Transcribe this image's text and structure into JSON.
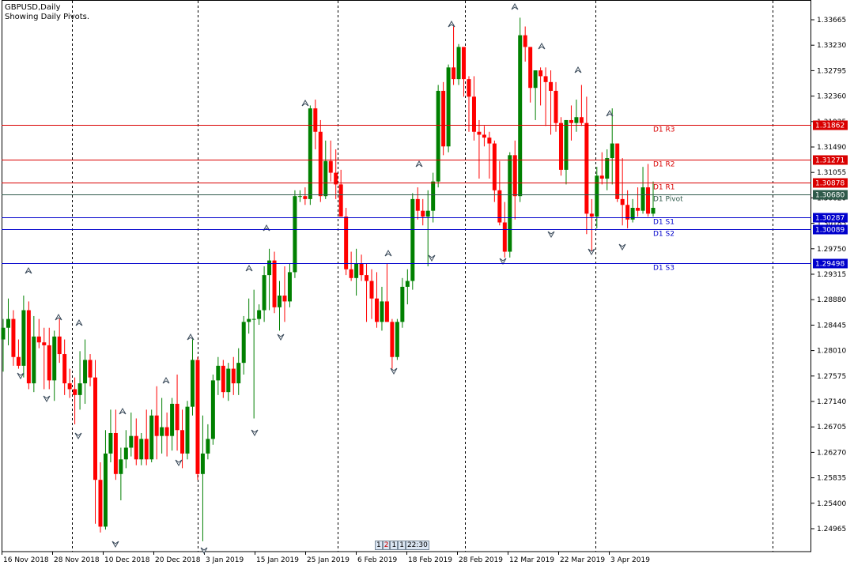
{
  "header": {
    "symbol_label": "GBPUSD,Daily",
    "indicator_label": "Showing Daily Pivots."
  },
  "counter": [
    "1",
    "2",
    "1",
    "1",
    "22:30"
  ],
  "colors": {
    "bull": "#008000",
    "bear": "#ff0000",
    "resistance": "#d90000",
    "support": "#0000cc",
    "pivot": "#2f5a4a",
    "grid": "#000000",
    "fractal": "#3a4a5a"
  },
  "chart_data": {
    "type": "candlestick",
    "symbol": "GBPUSD",
    "timeframe": "Daily",
    "ylim": [
      1.2475,
      1.339
    ],
    "y_ticks": [
      "1.33665",
      "1.33230",
      "1.32795",
      "1.32360",
      "1.31925",
      "1.31490",
      "1.31055",
      "1.30620",
      "1.30185",
      "1.29750",
      "1.29315",
      "1.28880",
      "1.28445",
      "1.28010",
      "1.27575",
      "1.27140",
      "1.26705",
      "1.26270",
      "1.25835",
      "1.25400",
      "1.24965"
    ],
    "x_labels": [
      "16 Nov 2018",
      "28 Nov 2018",
      "10 Dec 2018",
      "20 Dec 2018",
      "3 Jan 2019",
      "15 Jan 2019",
      "25 Jan 2019",
      "6 Feb 2019",
      "18 Feb 2019",
      "28 Feb 2019",
      "12 Mar 2019",
      "22 Mar 2019",
      "3 Apr 2019"
    ],
    "pivot_levels": [
      {
        "name": "D1 R3",
        "value": 1.31862,
        "label": "1.31862",
        "kind": "resistance"
      },
      {
        "name": "D1 R2",
        "value": 1.31271,
        "label": "1.31271",
        "kind": "resistance"
      },
      {
        "name": "D1 R1",
        "value": 1.30878,
        "label": "1.30878",
        "kind": "resistance"
      },
      {
        "name": "D1 Pivot",
        "value": 1.3068,
        "label": "1.30680",
        "kind": "pivot"
      },
      {
        "name": "D1 S1",
        "value": 1.30287,
        "label": "1.30287",
        "kind": "support"
      },
      {
        "name": "D1 S2",
        "value": 1.30089,
        "label": "1.30089",
        "kind": "support"
      },
      {
        "name": "D1 S3",
        "value": 1.29498,
        "label": "1.29498",
        "kind": "support"
      }
    ],
    "candles": [
      {
        "o": 1.282,
        "h": 1.2855,
        "l": 1.2765,
        "c": 1.284
      },
      {
        "o": 1.284,
        "h": 1.289,
        "l": 1.281,
        "c": 1.2855
      },
      {
        "o": 1.2855,
        "h": 1.287,
        "l": 1.2775,
        "c": 1.279
      },
      {
        "o": 1.279,
        "h": 1.282,
        "l": 1.277,
        "c": 1.2775
      },
      {
        "o": 1.2775,
        "h": 1.2895,
        "l": 1.2755,
        "c": 1.287
      },
      {
        "o": 1.287,
        "h": 1.2885,
        "l": 1.2735,
        "c": 1.2745
      },
      {
        "o": 1.2745,
        "h": 1.286,
        "l": 1.273,
        "c": 1.2825
      },
      {
        "o": 1.2825,
        "h": 1.2855,
        "l": 1.2805,
        "c": 1.2815
      },
      {
        "o": 1.2815,
        "h": 1.284,
        "l": 1.2735,
        "c": 1.281
      },
      {
        "o": 1.281,
        "h": 1.284,
        "l": 1.2735,
        "c": 1.275
      },
      {
        "o": 1.275,
        "h": 1.2835,
        "l": 1.2715,
        "c": 1.2825
      },
      {
        "o": 1.2825,
        "h": 1.286,
        "l": 1.278,
        "c": 1.2795
      },
      {
        "o": 1.2795,
        "h": 1.282,
        "l": 1.2725,
        "c": 1.2745
      },
      {
        "o": 1.2745,
        "h": 1.277,
        "l": 1.272,
        "c": 1.2735
      },
      {
        "o": 1.2735,
        "h": 1.2755,
        "l": 1.2675,
        "c": 1.2725
      },
      {
        "o": 1.2725,
        "h": 1.28,
        "l": 1.27,
        "c": 1.2745
      },
      {
        "o": 1.2745,
        "h": 1.282,
        "l": 1.271,
        "c": 1.2785
      },
      {
        "o": 1.2785,
        "h": 1.2795,
        "l": 1.274,
        "c": 1.2755
      },
      {
        "o": 1.2755,
        "h": 1.2785,
        "l": 1.2505,
        "c": 1.258
      },
      {
        "o": 1.258,
        "h": 1.261,
        "l": 1.249,
        "c": 1.25
      },
      {
        "o": 1.25,
        "h": 1.2665,
        "l": 1.2495,
        "c": 1.2625
      },
      {
        "o": 1.2625,
        "h": 1.27,
        "l": 1.261,
        "c": 1.266
      },
      {
        "o": 1.266,
        "h": 1.27,
        "l": 1.258,
        "c": 1.259
      },
      {
        "o": 1.259,
        "h": 1.2635,
        "l": 1.2545,
        "c": 1.2615
      },
      {
        "o": 1.2615,
        "h": 1.2665,
        "l": 1.26,
        "c": 1.2635
      },
      {
        "o": 1.2635,
        "h": 1.2695,
        "l": 1.262,
        "c": 1.2655
      },
      {
        "o": 1.2655,
        "h": 1.2685,
        "l": 1.2605,
        "c": 1.2615
      },
      {
        "o": 1.2615,
        "h": 1.266,
        "l": 1.2605,
        "c": 1.265
      },
      {
        "o": 1.265,
        "h": 1.27,
        "l": 1.2605,
        "c": 1.2615
      },
      {
        "o": 1.2615,
        "h": 1.27,
        "l": 1.261,
        "c": 1.269
      },
      {
        "o": 1.269,
        "h": 1.274,
        "l": 1.2615,
        "c": 1.2655
      },
      {
        "o": 1.2655,
        "h": 1.272,
        "l": 1.2625,
        "c": 1.267
      },
      {
        "o": 1.267,
        "h": 1.2695,
        "l": 1.262,
        "c": 1.2655
      },
      {
        "o": 1.2655,
        "h": 1.272,
        "l": 1.263,
        "c": 1.271
      },
      {
        "o": 1.271,
        "h": 1.276,
        "l": 1.263,
        "c": 1.2665
      },
      {
        "o": 1.2665,
        "h": 1.27,
        "l": 1.26,
        "c": 1.2625
      },
      {
        "o": 1.2625,
        "h": 1.2715,
        "l": 1.2615,
        "c": 1.2705
      },
      {
        "o": 1.2705,
        "h": 1.282,
        "l": 1.269,
        "c": 1.2785
      },
      {
        "o": 1.2785,
        "h": 1.279,
        "l": 1.258,
        "c": 1.259
      },
      {
        "o": 1.259,
        "h": 1.269,
        "l": 1.2475,
        "c": 1.2625
      },
      {
        "o": 1.2625,
        "h": 1.2675,
        "l": 1.2615,
        "c": 1.265
      },
      {
        "o": 1.265,
        "h": 1.276,
        "l": 1.264,
        "c": 1.275
      },
      {
        "o": 1.275,
        "h": 1.279,
        "l": 1.2725,
        "c": 1.2775
      },
      {
        "o": 1.2775,
        "h": 1.2785,
        "l": 1.272,
        "c": 1.273
      },
      {
        "o": 1.273,
        "h": 1.278,
        "l": 1.2715,
        "c": 1.277
      },
      {
        "o": 1.277,
        "h": 1.279,
        "l": 1.2725,
        "c": 1.2745
      },
      {
        "o": 1.2745,
        "h": 1.2805,
        "l": 1.2725,
        "c": 1.278
      },
      {
        "o": 1.278,
        "h": 1.286,
        "l": 1.276,
        "c": 1.285
      },
      {
        "o": 1.285,
        "h": 1.289,
        "l": 1.283,
        "c": 1.2855
      },
      {
        "o": 1.2855,
        "h": 1.2905,
        "l": 1.2685,
        "c": 1.2855
      },
      {
        "o": 1.2855,
        "h": 1.288,
        "l": 1.2845,
        "c": 1.287
      },
      {
        "o": 1.287,
        "h": 1.2945,
        "l": 1.285,
        "c": 1.293
      },
      {
        "o": 1.293,
        "h": 1.2975,
        "l": 1.287,
        "c": 1.2955
      },
      {
        "o": 1.2955,
        "h": 1.297,
        "l": 1.2865,
        "c": 1.2875
      },
      {
        "o": 1.2875,
        "h": 1.292,
        "l": 1.2835,
        "c": 1.2895
      },
      {
        "o": 1.2895,
        "h": 1.2945,
        "l": 1.285,
        "c": 1.2885
      },
      {
        "o": 1.2885,
        "h": 1.295,
        "l": 1.2875,
        "c": 1.2935
      },
      {
        "o": 1.2935,
        "h": 1.3075,
        "l": 1.2925,
        "c": 1.3065
      },
      {
        "o": 1.3065,
        "h": 1.3075,
        "l": 1.3055,
        "c": 1.3065
      },
      {
        "o": 1.3065,
        "h": 1.308,
        "l": 1.305,
        "c": 1.306
      },
      {
        "o": 1.306,
        "h": 1.322,
        "l": 1.305,
        "c": 1.3215
      },
      {
        "o": 1.3215,
        "h": 1.323,
        "l": 1.3145,
        "c": 1.3175
      },
      {
        "o": 1.3175,
        "h": 1.3195,
        "l": 1.3055,
        "c": 1.3065
      },
      {
        "o": 1.3065,
        "h": 1.316,
        "l": 1.306,
        "c": 1.3125
      },
      {
        "o": 1.3125,
        "h": 1.316,
        "l": 1.309,
        "c": 1.3105
      },
      {
        "o": 1.3105,
        "h": 1.3145,
        "l": 1.306,
        "c": 1.3085
      },
      {
        "o": 1.3085,
        "h": 1.311,
        "l": 1.303,
        "c": 1.303
      },
      {
        "o": 1.303,
        "h": 1.3045,
        "l": 1.293,
        "c": 1.294
      },
      {
        "o": 1.294,
        "h": 1.297,
        "l": 1.292,
        "c": 1.2925
      },
      {
        "o": 1.2925,
        "h": 1.2975,
        "l": 1.2895,
        "c": 1.295
      },
      {
        "o": 1.295,
        "h": 1.2965,
        "l": 1.292,
        "c": 1.293
      },
      {
        "o": 1.293,
        "h": 1.295,
        "l": 1.285,
        "c": 1.292
      },
      {
        "o": 1.292,
        "h": 1.294,
        "l": 1.2855,
        "c": 1.289
      },
      {
        "o": 1.289,
        "h": 1.2935,
        "l": 1.284,
        "c": 1.285
      },
      {
        "o": 1.285,
        "h": 1.291,
        "l": 1.2835,
        "c": 1.2885
      },
      {
        "o": 1.2885,
        "h": 1.295,
        "l": 1.287,
        "c": 1.285
      },
      {
        "o": 1.285,
        "h": 1.2855,
        "l": 1.277,
        "c": 1.279
      },
      {
        "o": 1.279,
        "h": 1.2855,
        "l": 1.2785,
        "c": 1.285
      },
      {
        "o": 1.285,
        "h": 1.2925,
        "l": 1.284,
        "c": 1.291
      },
      {
        "o": 1.291,
        "h": 1.294,
        "l": 1.288,
        "c": 1.292
      },
      {
        "o": 1.292,
        "h": 1.307,
        "l": 1.2905,
        "c": 1.306
      },
      {
        "o": 1.306,
        "h": 1.308,
        "l": 1.3025,
        "c": 1.304
      },
      {
        "o": 1.304,
        "h": 1.306,
        "l": 1.3015,
        "c": 1.303
      },
      {
        "o": 1.303,
        "h": 1.3075,
        "l": 1.2945,
        "c": 1.304
      },
      {
        "o": 1.304,
        "h": 1.3105,
        "l": 1.302,
        "c": 1.309
      },
      {
        "o": 1.309,
        "h": 1.3255,
        "l": 1.308,
        "c": 1.3245
      },
      {
        "o": 1.3245,
        "h": 1.326,
        "l": 1.3135,
        "c": 1.315
      },
      {
        "o": 1.315,
        "h": 1.329,
        "l": 1.314,
        "c": 1.3285
      },
      {
        "o": 1.3285,
        "h": 1.3355,
        "l": 1.3255,
        "c": 1.3265
      },
      {
        "o": 1.3265,
        "h": 1.3325,
        "l": 1.3255,
        "c": 1.332
      },
      {
        "o": 1.332,
        "h": 1.3275,
        "l": 1.3235,
        "c": 1.3265
      },
      {
        "o": 1.3265,
        "h": 1.327,
        "l": 1.3175,
        "c": 1.3235
      },
      {
        "o": 1.3235,
        "h": 1.327,
        "l": 1.316,
        "c": 1.3175
      },
      {
        "o": 1.3175,
        "h": 1.3195,
        "l": 1.3095,
        "c": 1.317
      },
      {
        "o": 1.317,
        "h": 1.3185,
        "l": 1.315,
        "c": 1.3165
      },
      {
        "o": 1.3165,
        "h": 1.3175,
        "l": 1.3095,
        "c": 1.3155
      },
      {
        "o": 1.3155,
        "h": 1.316,
        "l": 1.3055,
        "c": 1.3075
      },
      {
        "o": 1.3075,
        "h": 1.3125,
        "l": 1.3015,
        "c": 1.302
      },
      {
        "o": 1.302,
        "h": 1.3055,
        "l": 1.296,
        "c": 1.297
      },
      {
        "o": 1.297,
        "h": 1.314,
        "l": 1.296,
        "c": 1.3135
      },
      {
        "o": 1.3135,
        "h": 1.316,
        "l": 1.3025,
        "c": 1.3065
      },
      {
        "o": 1.3065,
        "h": 1.337,
        "l": 1.3055,
        "c": 1.334
      },
      {
        "o": 1.334,
        "h": 1.3355,
        "l": 1.3295,
        "c": 1.332
      },
      {
        "o": 1.332,
        "h": 1.3305,
        "l": 1.3225,
        "c": 1.325
      },
      {
        "o": 1.325,
        "h": 1.3265,
        "l": 1.3195,
        "c": 1.328
      },
      {
        "o": 1.328,
        "h": 1.3285,
        "l": 1.322,
        "c": 1.327
      },
      {
        "o": 1.327,
        "h": 1.3285,
        "l": 1.3185,
        "c": 1.326
      },
      {
        "o": 1.326,
        "h": 1.328,
        "l": 1.317,
        "c": 1.3245
      },
      {
        "o": 1.3245,
        "h": 1.326,
        "l": 1.3175,
        "c": 1.319
      },
      {
        "o": 1.319,
        "h": 1.32,
        "l": 1.31,
        "c": 1.311
      },
      {
        "o": 1.311,
        "h": 1.3195,
        "l": 1.3085,
        "c": 1.3195
      },
      {
        "o": 1.3195,
        "h": 1.322,
        "l": 1.316,
        "c": 1.319
      },
      {
        "o": 1.319,
        "h": 1.323,
        "l": 1.3175,
        "c": 1.32
      },
      {
        "o": 1.32,
        "h": 1.3255,
        "l": 1.3185,
        "c": 1.319
      },
      {
        "o": 1.319,
        "h": 1.3235,
        "l": 1.3,
        "c": 1.3035
      },
      {
        "o": 1.3035,
        "h": 1.306,
        "l": 1.297,
        "c": 1.303
      },
      {
        "o": 1.303,
        "h": 1.3115,
        "l": 1.301,
        "c": 1.31
      },
      {
        "o": 1.31,
        "h": 1.314,
        "l": 1.3085,
        "c": 1.3095
      },
      {
        "o": 1.3095,
        "h": 1.3145,
        "l": 1.3075,
        "c": 1.313
      },
      {
        "o": 1.313,
        "h": 1.3215,
        "l": 1.3085,
        "c": 1.3155
      },
      {
        "o": 1.3155,
        "h": 1.3155,
        "l": 1.3055,
        "c": 1.306
      },
      {
        "o": 1.306,
        "h": 1.313,
        "l": 1.3015,
        "c": 1.305
      },
      {
        "o": 1.305,
        "h": 1.3075,
        "l": 1.301,
        "c": 1.3025
      },
      {
        "o": 1.3025,
        "h": 1.306,
        "l": 1.302,
        "c": 1.3045
      },
      {
        "o": 1.3045,
        "h": 1.308,
        "l": 1.303,
        "c": 1.304
      },
      {
        "o": 1.304,
        "h": 1.3115,
        "l": 1.3035,
        "c": 1.308
      },
      {
        "o": 1.308,
        "h": 1.312,
        "l": 1.303,
        "c": 1.3035
      },
      {
        "o": 1.3035,
        "h": 1.309,
        "l": 1.303,
        "c": 1.3045
      }
    ]
  }
}
